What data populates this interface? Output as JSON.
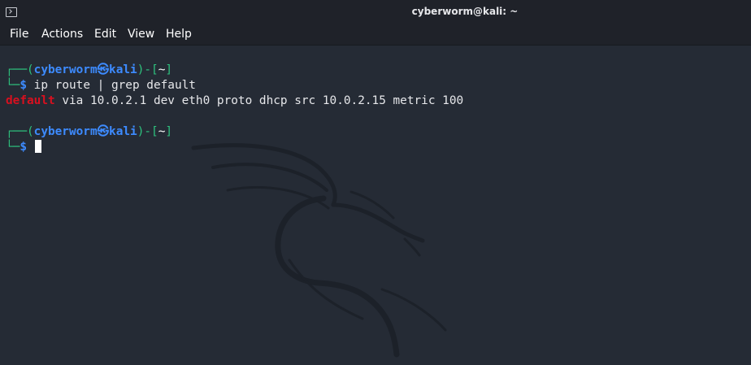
{
  "window": {
    "title": "cyberworm@kali: ~"
  },
  "menu": {
    "items": [
      "File",
      "Actions",
      "Edit",
      "View",
      "Help"
    ]
  },
  "terminal": {
    "prompt": {
      "corner_top": "┌──(",
      "user": "cyberworm",
      "at": "㉿",
      "host": "kali",
      "mid": ")-[",
      "dir": "~",
      "close": "]",
      "corner_bottom": "└─",
      "symbol": "$"
    },
    "command": "ip route | grep default",
    "output": {
      "match": "default",
      "rest": " via 10.0.2.1 dev eth0 proto dhcp src 10.0.2.15 metric 100"
    }
  },
  "colors": {
    "background": "#252b35",
    "prompt_lines": "#2ec27e",
    "user_host": "#3d8bff",
    "grep_match": "#d7101f"
  }
}
